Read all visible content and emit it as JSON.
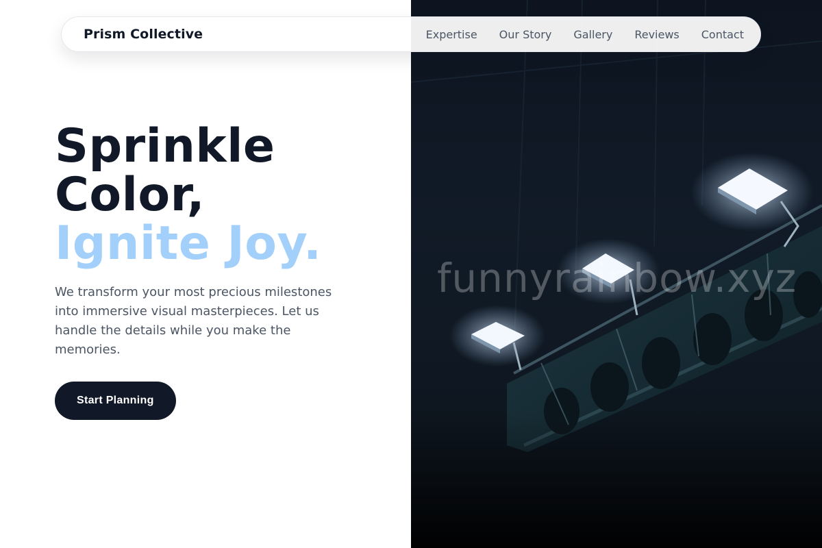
{
  "nav": {
    "brand": "Prism Collective",
    "links": [
      "Expertise",
      "Our Story",
      "Gallery",
      "Reviews",
      "Contact"
    ]
  },
  "hero": {
    "headline_line1": "Sprinkle",
    "headline_line2": "Color,",
    "headline_line3": "Ignite Joy.",
    "description": "We transform your most precious milestones into immersive visual masterpieces. Let us handle the details while you make the memories.",
    "cta_label": "Start Planning"
  },
  "image": {
    "subject": "stage-lights-photo",
    "watermark": "funnyrainbow.xyz"
  },
  "colors": {
    "accent": "#a3d0fb",
    "dark": "#111827",
    "text_muted": "#4b5563"
  }
}
